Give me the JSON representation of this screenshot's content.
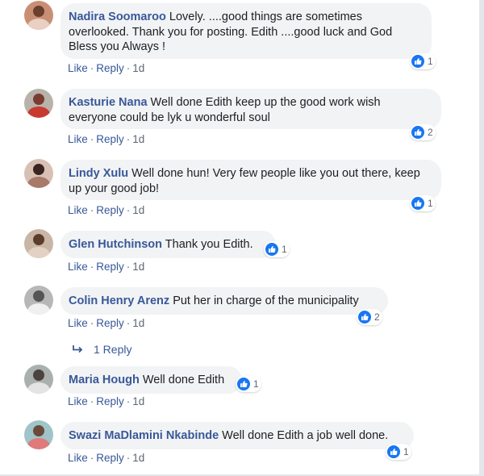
{
  "colors": {
    "author": "#385898",
    "bubble": "#f2f3f5",
    "like_blue": "#1877f2",
    "meta": "#606770"
  },
  "icons": {
    "like": "thumbs-up-icon",
    "reply_arrow": "reply-arrow-icon"
  },
  "comments": [
    {
      "author": "Nadira Soomaroo",
      "text": "Lovely. ....good things are sometimes overlooked. Thank you for posting. Edith ....good luck and God Bless you Always !",
      "reaction_count": "1",
      "like_label": "Like",
      "reply_label": "Reply",
      "time": "1d"
    },
    {
      "author": "Kasturie Nana",
      "text": "Well done Edith keep up the good work wish everyone could be lyk u wonderful soul",
      "reaction_count": "2",
      "like_label": "Like",
      "reply_label": "Reply",
      "time": "1d"
    },
    {
      "author": "Lindy Xulu",
      "text": "Well done hun! Very few people like you out there, keep up your good job!",
      "reaction_count": "1",
      "like_label": "Like",
      "reply_label": "Reply",
      "time": "1d"
    },
    {
      "author": "Glen Hutchinson",
      "text": "Thank you Edith.",
      "reaction_count": "1",
      "like_label": "Like",
      "reply_label": "Reply",
      "time": "1d"
    },
    {
      "author": "Colin Henry Arenz",
      "text": "Put her in charge of the municipality",
      "reaction_count": "2",
      "like_label": "Like",
      "reply_label": "Reply",
      "time": "1d",
      "replies_label": "1 Reply"
    },
    {
      "author": "Maria Hough",
      "text": "Well done Edith",
      "reaction_count": "1",
      "like_label": "Like",
      "reply_label": "Reply",
      "time": "1d"
    },
    {
      "author": "Swazi MaDlamini Nkabinde",
      "text": "Well done Edith a job well done.",
      "reaction_count": "1",
      "like_label": "Like",
      "reply_label": "Reply",
      "time": "1d"
    }
  ]
}
